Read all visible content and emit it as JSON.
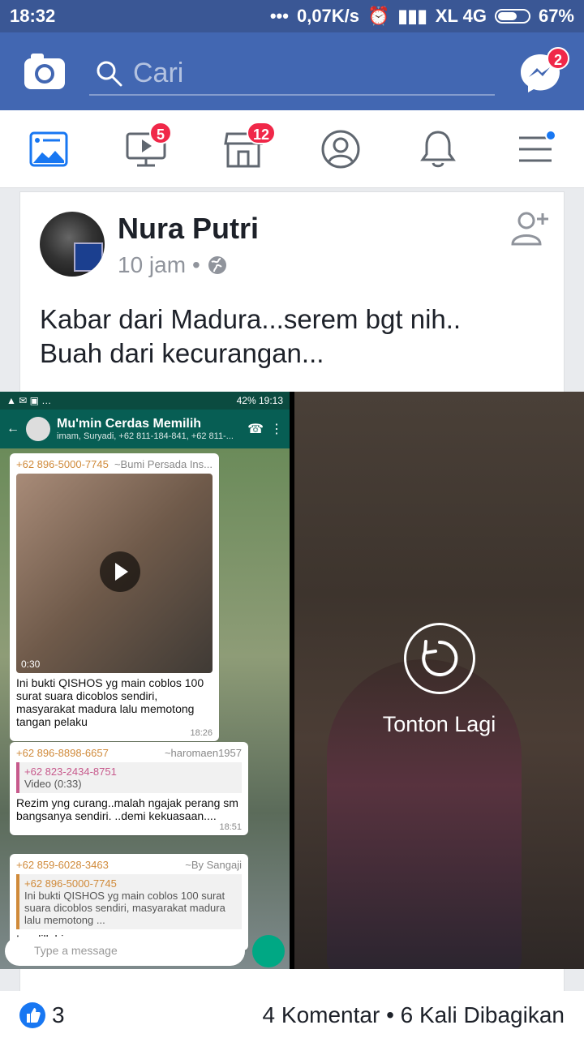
{
  "status_bar": {
    "time": "18:32",
    "network_speed": "0,07K/s",
    "carrier": "XL 4G",
    "battery": "67%",
    "battery_level": 0.67
  },
  "header": {
    "search_placeholder": "Cari",
    "messenger_badge": "2"
  },
  "tabs": [
    {
      "name": "news-feed",
      "icon": "news-feed-icon",
      "badge": ""
    },
    {
      "name": "watch",
      "icon": "video-icon",
      "badge": "5"
    },
    {
      "name": "marketplace",
      "icon": "marketplace-icon",
      "badge": "12"
    },
    {
      "name": "profile",
      "icon": "profile-icon",
      "badge": ""
    },
    {
      "name": "notifications",
      "icon": "bell-icon",
      "badge": ""
    },
    {
      "name": "menu",
      "icon": "menu-icon",
      "badge": ""
    }
  ],
  "post": {
    "author": "Nura Putri",
    "time": "10 jam",
    "privacy_icon": "globe-icon",
    "text_line1": "Kabar dari Madura...serem bgt nih..",
    "text_line2": "Buah dari kecurangan..."
  },
  "screenshot": {
    "status_time": "19:13",
    "battery": "42%",
    "group_name": "Mu'min Cerdas Memilih",
    "group_members": "imam, Suryadi, +62 811-184-841, +62 811-...",
    "msg1_sender": "+62 896-5000-7745",
    "msg1_alias": "~Bumi Persada Ins...",
    "msg1_video_duration": "0:30",
    "msg1_text": "Ini bukti QISHOS yg main coblos 100 surat suara dicoblos sendiri, masyarakat madura lalu memotong tangan pelaku",
    "msg1_time": "18:26",
    "msg2_sender": "+62 896-8898-6657",
    "msg2_alias": "~haromaen1957",
    "msg2_quote_sender": "+62 823-2434-8751",
    "msg2_quote_text": "Video (0:33)",
    "msg2_text": "Rezim yng curang..malah ngajak perang sm bangsanya sendiri. ..demi kekuasaan....",
    "msg2_time": "18:51",
    "msg3_sender": "+62 859-6028-3463",
    "msg3_alias": "~By Sangaji",
    "msg3_quote_sender": "+62 896-5000-7745",
    "msg3_quote_text": "Ini bukti QISHOS yg main coblos 100 surat suara dicoblos sendiri, masyarakat madura lalu memotong ...",
    "partial_text": "Innalillahi",
    "input_placeholder": "Type a message"
  },
  "video": {
    "replay_label": "Tonton Lagi"
  },
  "footer": {
    "likes": "3",
    "stats": "4 Komentar • 6 Kali Dibagikan"
  },
  "colors": {
    "header_blue": "#4267b2",
    "statusbar_blue": "#3a5795",
    "badge_red": "#f02849",
    "like_blue": "#1877f2",
    "whatsapp_green": "#075e54"
  }
}
